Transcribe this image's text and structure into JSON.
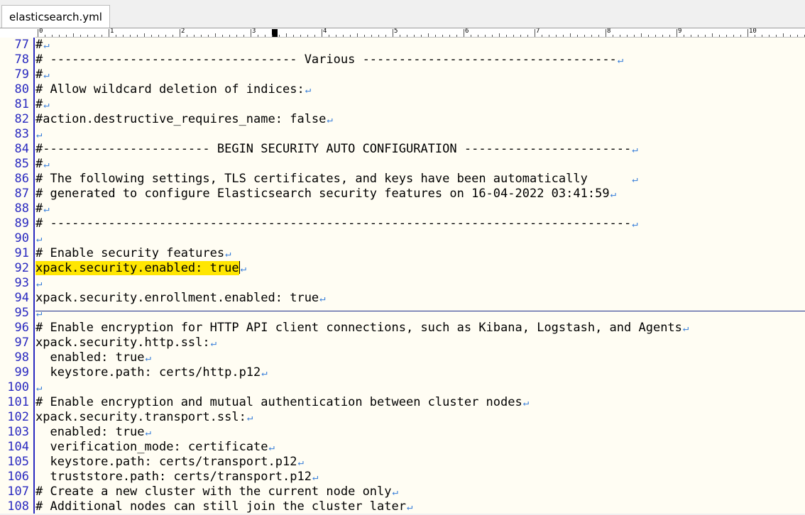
{
  "tab": {
    "title": "elasticsearch.yml"
  },
  "ruler": {
    "marks": [
      "0",
      "1",
      "2",
      "3",
      "4",
      "5",
      "6",
      "7",
      "8",
      "9",
      "10"
    ]
  },
  "eol_symbol": "↵",
  "lines": [
    {
      "num": "77",
      "text": "#"
    },
    {
      "num": "78",
      "text": "# ---------------------------------- Various -----------------------------------"
    },
    {
      "num": "79",
      "text": "#"
    },
    {
      "num": "80",
      "text": "# Allow wildcard deletion of indices:"
    },
    {
      "num": "81",
      "text": "#"
    },
    {
      "num": "82",
      "text": "#action.destructive_requires_name: false"
    },
    {
      "num": "83",
      "text": ""
    },
    {
      "num": "84",
      "text": "#----------------------- BEGIN SECURITY AUTO CONFIGURATION -----------------------"
    },
    {
      "num": "85",
      "text": "#"
    },
    {
      "num": "86",
      "text": "# The following settings, TLS certificates, and keys have been automatically      "
    },
    {
      "num": "87",
      "text": "# generated to configure Elasticsearch security features on 16-04-2022 03:41:59"
    },
    {
      "num": "88",
      "text": "#"
    },
    {
      "num": "89",
      "text": "# --------------------------------------------------------------------------------"
    },
    {
      "num": "90",
      "text": ""
    },
    {
      "num": "91",
      "text": "# Enable security features"
    },
    {
      "num": "92",
      "text": "xpack.security.enabled: true",
      "highlight": true,
      "cursor": true
    },
    {
      "num": "93",
      "text": ""
    },
    {
      "num": "94",
      "text": "xpack.security.enrollment.enabled: true"
    },
    {
      "num": "95",
      "text": ""
    },
    {
      "num": "96",
      "text": "# Enable encryption for HTTP API client connections, such as Kibana, Logstash, and Agents"
    },
    {
      "num": "97",
      "text": "xpack.security.http.ssl:"
    },
    {
      "num": "98",
      "text": "  enabled: true"
    },
    {
      "num": "99",
      "text": "  keystore.path: certs/http.p12"
    },
    {
      "num": "100",
      "text": ""
    },
    {
      "num": "101",
      "text": "# Enable encryption and mutual authentication between cluster nodes"
    },
    {
      "num": "102",
      "text": "xpack.security.transport.ssl:"
    },
    {
      "num": "103",
      "text": "  enabled: true"
    },
    {
      "num": "104",
      "text": "  verification_mode: certificate"
    },
    {
      "num": "105",
      "text": "  keystore.path: certs/transport.p12"
    },
    {
      "num": "106",
      "text": "  truststore.path: certs/transport.p12"
    },
    {
      "num": "107",
      "text": "# Create a new cluster with the current node only"
    },
    {
      "num": "108",
      "text": "# Additional nodes can still join the cluster later"
    }
  ]
}
